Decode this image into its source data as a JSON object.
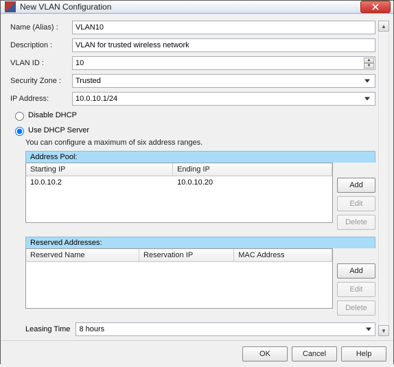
{
  "window": {
    "title": "New VLAN Configuration"
  },
  "form": {
    "name_label": "Name (Alias) :",
    "name_value": "VLAN10",
    "desc_label": "Description :",
    "desc_value": "VLAN for trusted wireless network",
    "vlanid_label": "VLAN ID :",
    "vlanid_value": "10",
    "zone_label": "Security Zone :",
    "zone_value": "Trusted",
    "ip_label": "IP Address:",
    "ip_value": "10.0.10.1/24"
  },
  "dhcp": {
    "disable_label": "Disable DHCP",
    "use_label": "Use DHCP Server",
    "selected": "use",
    "note": "You can configure a maximum of six address ranges."
  },
  "pool": {
    "title": "Address Pool:",
    "columns": {
      "start": "Starting IP",
      "end": "Ending IP"
    },
    "rows": [
      {
        "start": "10.0.10.2",
        "end": "10.0.10.20"
      }
    ],
    "buttons": {
      "add": "Add",
      "edit": "Edit",
      "delete": "Delete"
    }
  },
  "reserved": {
    "title": "Reserved Addresses:",
    "columns": {
      "name": "Reserved Name",
      "ip": "Reservation IP",
      "mac": "MAC Address"
    },
    "rows": [],
    "buttons": {
      "add": "Add",
      "edit": "Edit",
      "delete": "Delete"
    }
  },
  "leasing": {
    "label": "Leasing Time",
    "value": "8 hours"
  },
  "footer": {
    "ok": "OK",
    "cancel": "Cancel",
    "help": "Help"
  }
}
